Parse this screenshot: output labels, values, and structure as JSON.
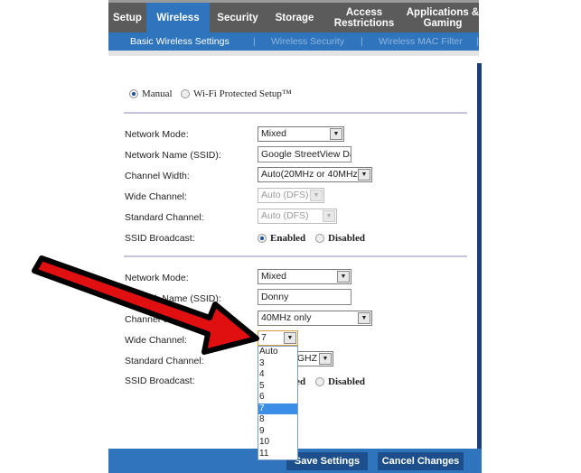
{
  "tabs": [
    "Setup",
    "Wireless",
    "Security",
    "Storage",
    "Access Restrictions",
    "Applications & Gaming"
  ],
  "subnav": {
    "items": [
      "Basic Wireless Settings",
      "Wireless Security",
      "Wireless MAC Filter"
    ],
    "sep": "|"
  },
  "setup_mode": {
    "manual": "Manual",
    "wps": "Wi-Fi Protected Setup™",
    "selected": "Manual"
  },
  "labels": {
    "mode": "Network Mode:",
    "ssid": "Network Name (SSID):",
    "width": "Channel Width:",
    "wide": "Wide Channel:",
    "standard": "Standard Channel:",
    "broadcast": "SSID Broadcast:"
  },
  "radio": {
    "enabled": "Enabled",
    "disabled": "Disabled"
  },
  "section1": {
    "mode": "Mixed",
    "ssid": "Google StreetView Dat",
    "width": "Auto(20MHz or 40MHz)",
    "wide": "Auto (DFS)",
    "standard": "Auto (DFS)",
    "broadcast": "Enabled"
  },
  "section2": {
    "mode": "Mixed",
    "ssid": "Donny",
    "width": "40MHz only",
    "wide": "7",
    "standard": "6 - 2.437GHZ"
  },
  "dropdown_options": [
    "Auto",
    "3",
    "4",
    "5",
    "6",
    "7",
    "8",
    "9",
    "10",
    "11"
  ],
  "dropdown_selected": "7",
  "buttons": {
    "save": "Save Settings",
    "cancel": "Cancel Changes"
  },
  "colors": {
    "accent": "#2f75bd",
    "arrow": "#e01010"
  }
}
